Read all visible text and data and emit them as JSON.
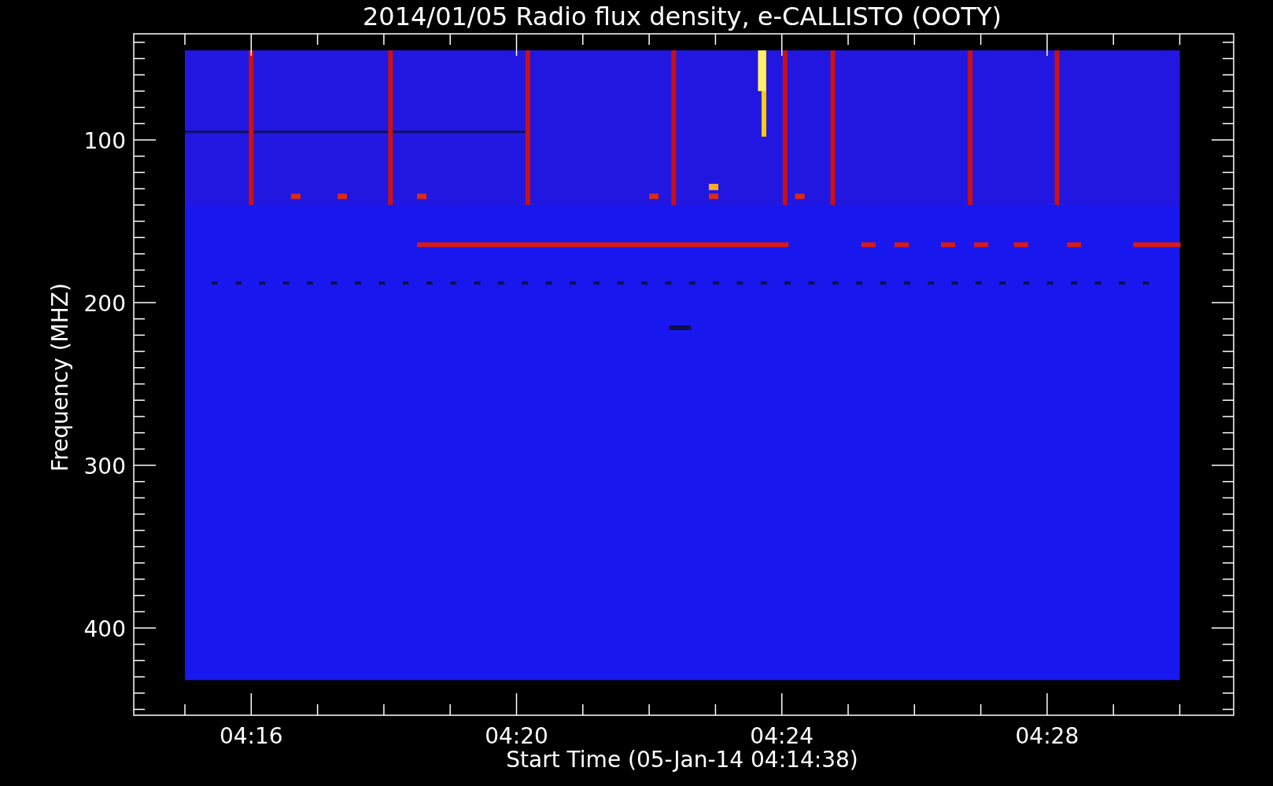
{
  "title": "2014/01/05  Radio flux density, e-CALLISTO (OOTY)",
  "y_axis": {
    "label": "Frequency (MHZ)",
    "ticks": [
      "100",
      "200",
      "300",
      "400"
    ]
  },
  "x_axis": {
    "label": "Start Time (05-Jan-14 04:14:38)",
    "ticks": [
      "04:16",
      "04:20",
      "04:24",
      "04:28"
    ]
  }
}
